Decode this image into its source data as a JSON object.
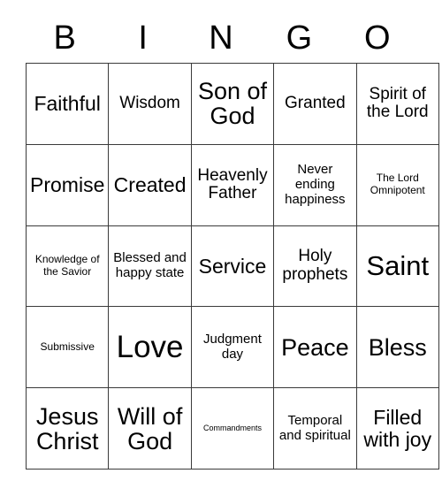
{
  "card": {
    "header_letters": [
      "B",
      "I",
      "N",
      "G",
      "O"
    ],
    "background_color": "#ffffff",
    "text_color": "#000000",
    "border_color": "#3a3a3a",
    "rows": [
      [
        {
          "text": "Faithful",
          "size": "fs-xl"
        },
        {
          "text": "Wisdom",
          "size": "fs-lg"
        },
        {
          "text": "Son of God",
          "size": "fs-2xl"
        },
        {
          "text": "Granted",
          "size": "fs-lg"
        },
        {
          "text": "Spirit of the Lord",
          "size": "fs-lg"
        }
      ],
      [
        {
          "text": "Promise",
          "size": "fs-xl"
        },
        {
          "text": "Created",
          "size": "fs-xl"
        },
        {
          "text": "Heavenly Father",
          "size": "fs-lg"
        },
        {
          "text": "Never ending happiness",
          "size": "fs-md"
        },
        {
          "text": "The Lord Omnipotent",
          "size": "fs-sm"
        }
      ],
      [
        {
          "text": "Knowledge of the Savior",
          "size": "fs-sm"
        },
        {
          "text": "Blessed and happy state",
          "size": "fs-md"
        },
        {
          "text": "Service",
          "size": "fs-xl"
        },
        {
          "text": "Holy prophets",
          "size": "fs-lg"
        },
        {
          "text": "Saint",
          "size": "fs-3xl"
        }
      ],
      [
        {
          "text": "Submissive",
          "size": "fs-sm"
        },
        {
          "text": "Love",
          "size": "fs-4xl"
        },
        {
          "text": "Judgment day",
          "size": "fs-md"
        },
        {
          "text": "Peace",
          "size": "fs-2xl"
        },
        {
          "text": "Bless",
          "size": "fs-2xl"
        }
      ],
      [
        {
          "text": "Jesus Christ",
          "size": "fs-2xl"
        },
        {
          "text": "Will of God",
          "size": "fs-2xl"
        },
        {
          "text": "Commandments",
          "size": "fs-xs"
        },
        {
          "text": "Temporal and spiritual",
          "size": "fs-md"
        },
        {
          "text": "Filled with joy",
          "size": "fs-xl"
        }
      ]
    ]
  }
}
